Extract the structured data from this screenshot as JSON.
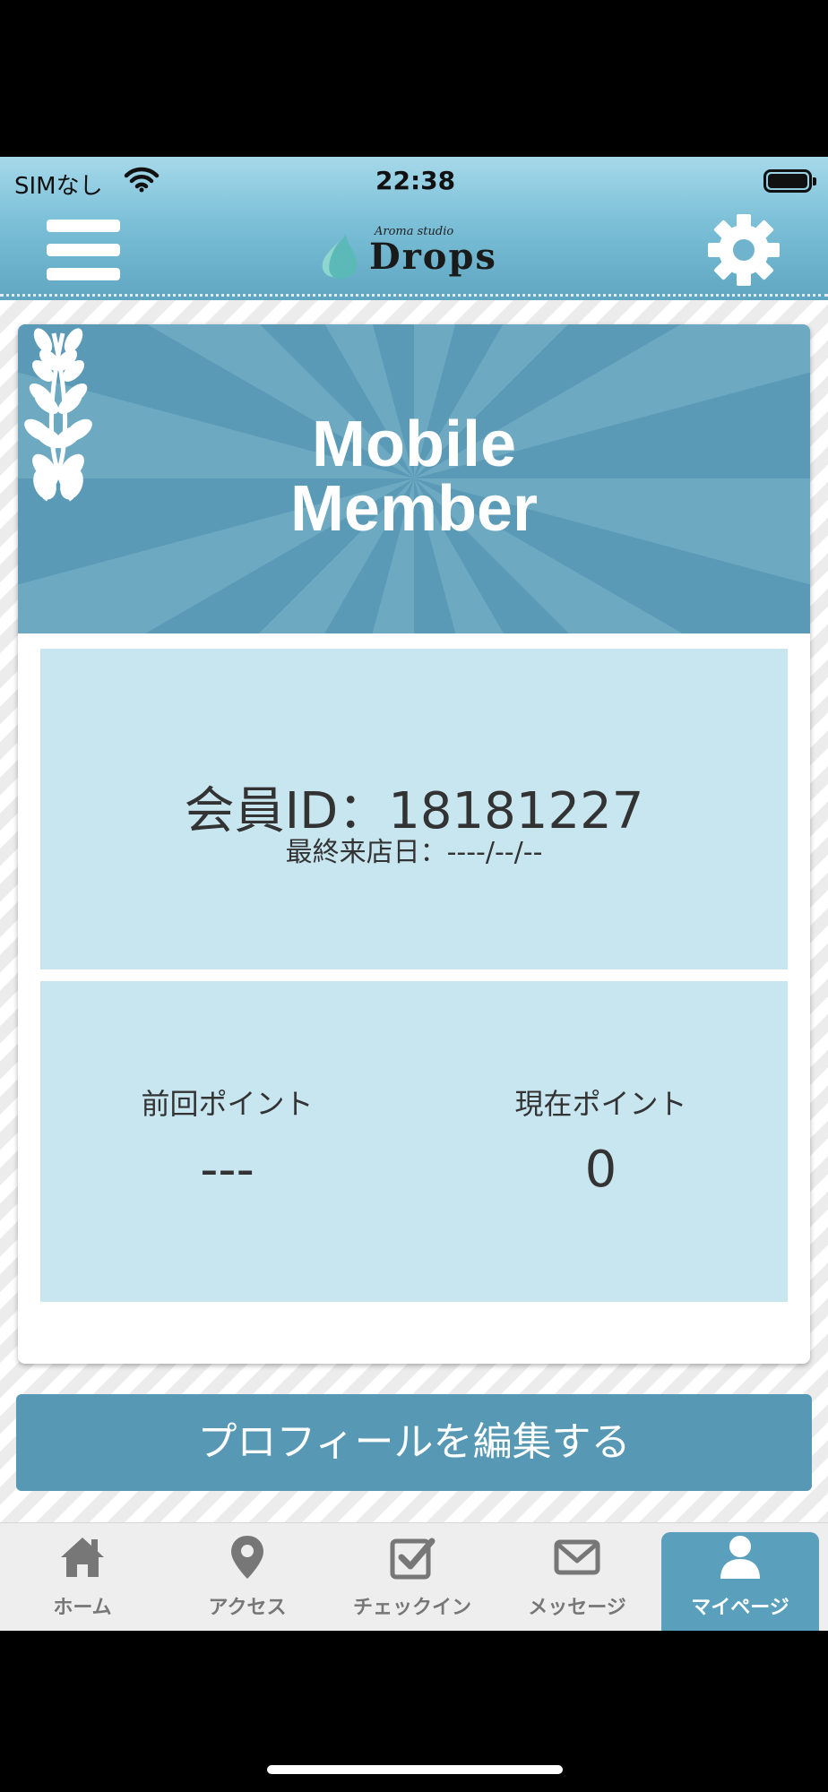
{
  "status_bar": {
    "carrier": "SIMなし",
    "time": "22:38"
  },
  "header": {
    "logo_sub": "Aroma studio",
    "logo_main": "Drops"
  },
  "banner": {
    "line1": "Mobile",
    "line2": "Member"
  },
  "member": {
    "id_text": "会員ID：18181227",
    "last_visit_text": "最終来店日：----/--/--"
  },
  "points": {
    "previous_label": "前回ポイント",
    "previous_value": "---",
    "current_label": "現在ポイント",
    "current_value": "0"
  },
  "edit_profile_label": "プロフィールを編集する",
  "tabs": [
    {
      "label": "ホーム",
      "icon": "home-icon",
      "active": false
    },
    {
      "label": "アクセス",
      "icon": "map-pin-icon",
      "active": false
    },
    {
      "label": "チェックイン",
      "icon": "checkbox-icon",
      "active": false
    },
    {
      "label": "メッセージ",
      "icon": "envelope-icon",
      "active": false
    },
    {
      "label": "マイページ",
      "icon": "user-icon",
      "active": true
    }
  ],
  "colors": {
    "accent": "#5799b5",
    "panel": "#c8e6f0",
    "header": "#7cc0d8"
  }
}
